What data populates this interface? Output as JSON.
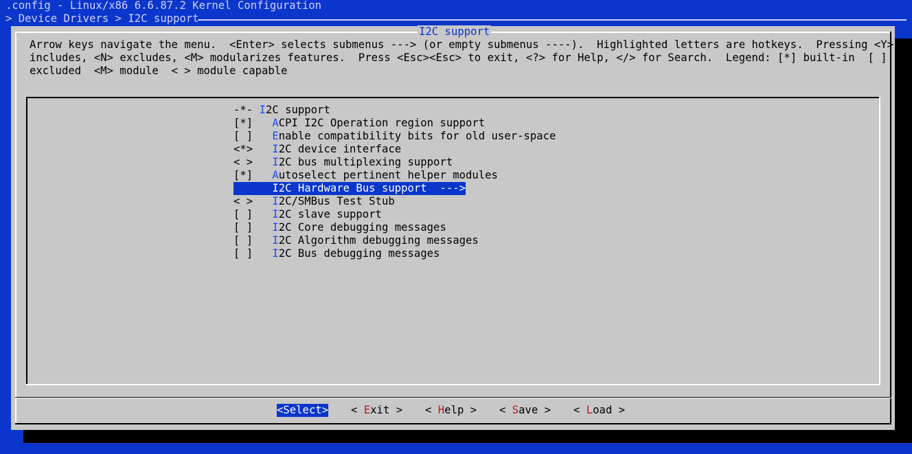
{
  "header": {
    "title": ".config - Linux/x86 6.6.87.2 Kernel Configuration",
    "breadcrumb": "> Device Drivers > I2C support"
  },
  "dialog": {
    "title": "I2C support",
    "help_lines": [
      "Arrow keys navigate the menu.  <Enter> selects submenus ---> (or empty submenus ----).  Highlighted letters are hotkeys.  Pressing <Y>",
      "includes, <N> excludes, <M> modularizes features.  Press <Esc><Esc> to exit, <?> for Help, </> for Search.  Legend: [*] built-in  [ ]",
      "excluded  <M> module  < > module capable"
    ]
  },
  "menu": {
    "items": [
      {
        "prefix": "-*- ",
        "hotkey": "I",
        "rest": "2C support",
        "selected": false
      },
      {
        "prefix": "[*]   ",
        "hotkey": "A",
        "rest": "CPI I2C Operation region support",
        "selected": false
      },
      {
        "prefix": "[ ]   ",
        "hotkey": "E",
        "rest": "nable compatibility bits for old user-space",
        "selected": false
      },
      {
        "prefix": "<*>   ",
        "hotkey": "I",
        "rest": "2C device interface",
        "selected": false
      },
      {
        "prefix": "< >   ",
        "hotkey": "I",
        "rest": "2C bus multiplexing support",
        "selected": false
      },
      {
        "prefix": "[*]   ",
        "hotkey": "A",
        "rest": "utoselect pertinent helper modules",
        "selected": false
      },
      {
        "prefix": "      ",
        "hotkey": "I",
        "rest": "2C Hardware Bus support  --->",
        "selected": true
      },
      {
        "prefix": "< >   ",
        "hotkey": "I",
        "rest": "2C/SMBus Test Stub",
        "selected": false
      },
      {
        "prefix": "[ ]   ",
        "hotkey": "I",
        "rest": "2C slave support",
        "selected": false
      },
      {
        "prefix": "[ ]   ",
        "hotkey": "I",
        "rest": "2C Core debugging messages",
        "selected": false
      },
      {
        "prefix": "[ ]   ",
        "hotkey": "I",
        "rest": "2C Algorithm debugging messages",
        "selected": false
      },
      {
        "prefix": "[ ]   ",
        "hotkey": "I",
        "rest": "2C Bus debugging messages",
        "selected": false
      }
    ]
  },
  "buttons": {
    "select": "<Select>",
    "exit": {
      "pre": "< ",
      "hotkey": "E",
      "post": "xit >"
    },
    "help": {
      "pre": "< ",
      "hotkey": "H",
      "post": "elp >"
    },
    "save": {
      "pre": "< ",
      "hotkey": "S",
      "post": "ave >"
    },
    "load": {
      "pre": "< ",
      "hotkey": "L",
      "post": "oad >"
    }
  },
  "colors": {
    "background": "#0a36cc",
    "dialog": "#c8c8c8",
    "hotkey": "#1a4cff",
    "button_hotkey": "#c01818"
  }
}
